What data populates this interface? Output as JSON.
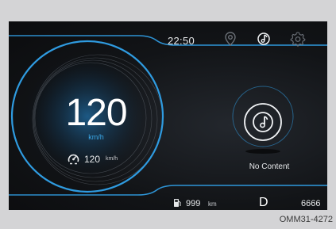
{
  "status_bar": {
    "time": "22:50",
    "icons": [
      "location-pin-icon",
      "media-icon",
      "settings-gear-icon"
    ]
  },
  "speedometer": {
    "speed": "120",
    "unit": "km/h"
  },
  "cruise_control": {
    "icon": "cruise-control-icon",
    "set_speed": "120",
    "unit": "km/h"
  },
  "media_panel": {
    "icon": "music-note-icon",
    "status": "No Content"
  },
  "bottom_bar": {
    "fuel_icon": "fuel-pump-icon",
    "range_value": "999",
    "range_unit": "km",
    "gear": "D",
    "odometer": "6666"
  },
  "caption": "OMM31-4272",
  "colors": {
    "accent": "#2f9be0",
    "background": "#121417",
    "frame": "#d4d4d6"
  }
}
